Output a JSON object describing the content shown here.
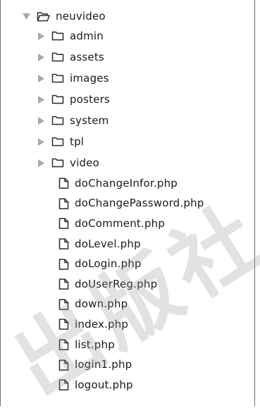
{
  "tree": {
    "root": {
      "label": "neuvideo",
      "expanded": true,
      "icon": "folder-open-icon"
    },
    "folders": [
      {
        "label": "admin",
        "icon": "folder-icon"
      },
      {
        "label": "assets",
        "icon": "folder-icon"
      },
      {
        "label": "images",
        "icon": "folder-icon"
      },
      {
        "label": "posters",
        "icon": "folder-icon"
      },
      {
        "label": "system",
        "icon": "folder-icon"
      },
      {
        "label": "tpl",
        "icon": "folder-icon"
      },
      {
        "label": "video",
        "icon": "folder-icon"
      }
    ],
    "files": [
      {
        "label": "doChangeInfor.php",
        "icon": "file-icon"
      },
      {
        "label": "doChangePassword.php",
        "icon": "file-icon"
      },
      {
        "label": "doComment.php",
        "icon": "file-icon"
      },
      {
        "label": "doLevel.php",
        "icon": "file-icon"
      },
      {
        "label": "doLogin.php",
        "icon": "file-icon"
      },
      {
        "label": "doUserReg.php",
        "icon": "file-icon"
      },
      {
        "label": "down.php",
        "icon": "file-icon"
      },
      {
        "label": "index.php",
        "icon": "file-icon"
      },
      {
        "label": "list.php",
        "icon": "file-icon"
      },
      {
        "label": "login1.php",
        "icon": "file-icon"
      },
      {
        "label": "logout.php",
        "icon": "file-icon"
      }
    ]
  },
  "watermark": {
    "text": "出版社"
  },
  "colors": {
    "arrow": "#a9a9a9",
    "icon_stroke": "#2b2b2b",
    "text": "#1a1a1a",
    "border": "#6f6f6f"
  }
}
